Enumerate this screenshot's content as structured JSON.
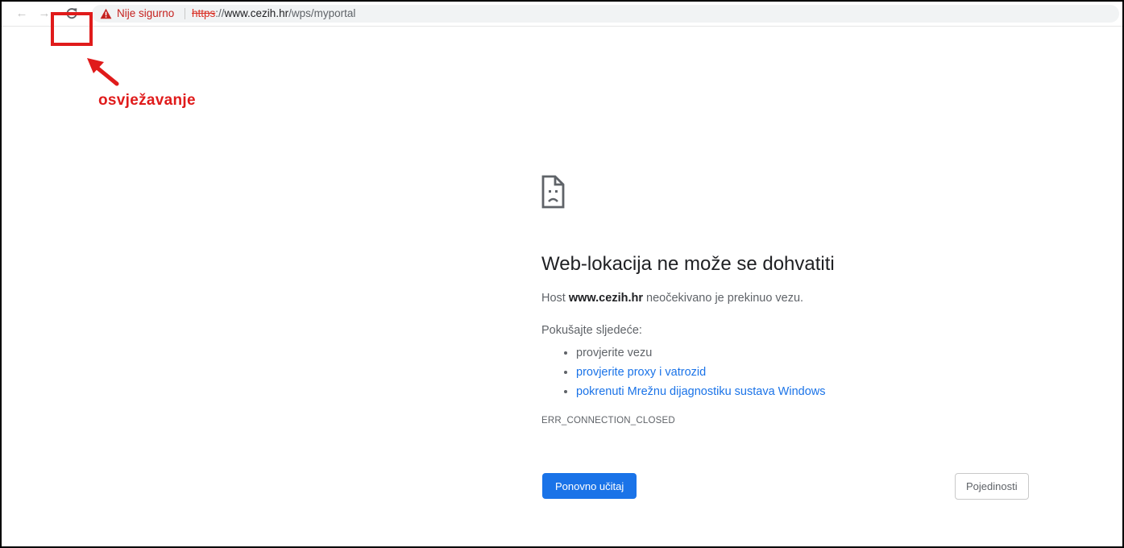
{
  "browser": {
    "security_label": "Nije sigurno",
    "url_scheme": "https",
    "url_rest_prefix": "://",
    "url_host": "www.cezih.hr",
    "url_path": "/wps/myportal"
  },
  "annotation": {
    "label": "osvježavanje",
    "color": "#e01b1b"
  },
  "error": {
    "title": "Web-lokacija ne može se dohvatiti",
    "desc_prefix": "Host",
    "desc_host": "www.cezih.hr",
    "desc_suffix": "neočekivano je prekinuo vezu.",
    "try_heading": "Pokušajte sljedeće:",
    "suggestions": [
      {
        "text": "provjerite vezu",
        "link": false
      },
      {
        "text": "provjerite proxy i vatrozid",
        "link": true
      },
      {
        "text": "pokrenuti Mrežnu dijagnostiku sustava Windows",
        "link": true
      }
    ],
    "code": "ERR_CONNECTION_CLOSED"
  },
  "buttons": {
    "reload": "Ponovno učitaj",
    "details": "Pojedinosti"
  },
  "icons": {
    "back": "arrow-left-icon",
    "forward": "arrow-right-icon",
    "reload": "reload-icon",
    "warning": "warning-triangle-icon",
    "error": "sad-document-icon"
  },
  "colors": {
    "accent": "#1a73e8",
    "warning": "#c5221f",
    "annotation": "#e01b1b"
  }
}
